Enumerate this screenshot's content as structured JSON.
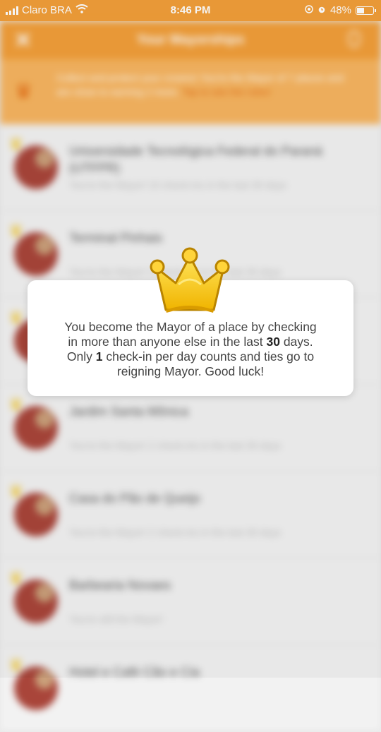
{
  "status_bar": {
    "carrier": "Claro BRA",
    "time": "8:46 PM",
    "battery": "48%",
    "icons": [
      "signal-icon",
      "wifi-icon",
      "location-icon",
      "alarm-icon",
      "battery-icon"
    ]
  },
  "navbar": {
    "title": "Your Mayorships"
  },
  "banner": {
    "text": "Collect and protect your crowns! You're the Mayor of 7 places and are close to earning 2 more.",
    "link": "Tap to see the rules!"
  },
  "mayorships": [
    {
      "name": "Universidade Tecnológica Federal do Paraná (UTFPR)",
      "detail": "You're the Mayor! 10 check-ins in the last 30 days"
    },
    {
      "name": "Terminal Pinhais",
      "detail": "You're the Mayor! 4 check-ins in the last 30 days"
    },
    {
      "name": "",
      "detail": ""
    },
    {
      "name": "Jardim Santa Mônica",
      "detail": "You're the Mayor! 2 check-ins in the last 30 days"
    },
    {
      "name": "Casa do Pão de Queijo",
      "detail": "You're the Mayor! 2 check-ins in the last 30 days"
    },
    {
      "name": "Barbearia Novaes",
      "detail": "You're still the Mayor!"
    },
    {
      "name": "Hotel e Café Cão e Cia",
      "detail": ""
    }
  ],
  "modal": {
    "line1": "You become the Mayor of a place by checking",
    "line2_pre": "in more than anyone else in the last ",
    "days": "30",
    "line2_post": " days.",
    "line3_pre": "Only ",
    "checkins": "1",
    "line3_post": " check-in per day counts and ties go to",
    "line4": "reigning Mayor. Good luck!"
  },
  "colors": {
    "brand_orange": "#f29f3a",
    "crown_gold": "#f5c518",
    "banner_link": "#e46a12"
  }
}
